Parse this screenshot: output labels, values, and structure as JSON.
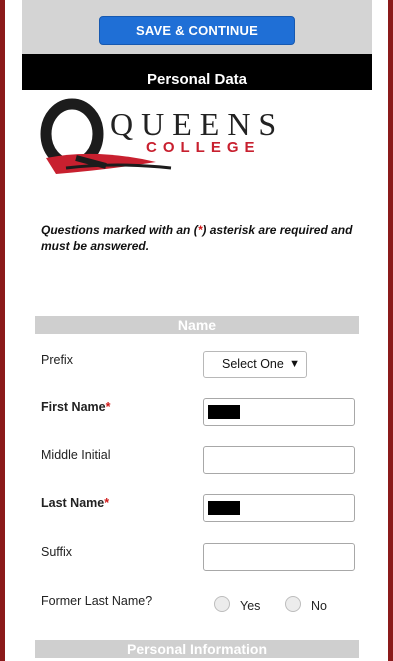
{
  "header": {
    "save_label": "SAVE & CONTINUE",
    "section_title": "Personal Data"
  },
  "logo": {
    "letter": "Q",
    "name_line1": "QUEENS",
    "name_line2": "COLLEGE"
  },
  "notice": {
    "part1": "Questions marked with an (",
    "star": "*",
    "part2": ") asterisk are required and must be answered."
  },
  "sections": {
    "name_title": "Name",
    "personal_info_title": "Personal Information"
  },
  "fields": {
    "prefix_label": "Prefix",
    "prefix_value": "Select One",
    "first_name_label": "First Name",
    "middle_initial_label": "Middle Initial",
    "last_name_label": "Last Name",
    "suffix_label": "Suffix",
    "former_last_name_label": "Former Last Name?",
    "required_marker": "*",
    "yes_label": "Yes",
    "no_label": "No"
  },
  "colors": {
    "frame": "#8b1a1a",
    "button": "#1f6fd6",
    "section_header": "#cfcfcf",
    "required": "#d01818"
  }
}
